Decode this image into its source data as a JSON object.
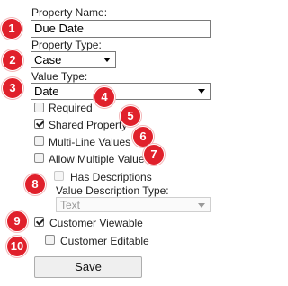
{
  "form": {
    "property_name_label": "Property Name:",
    "property_name_value": "Due Date",
    "property_type_label": "Property Type:",
    "property_type_value": "Case",
    "value_type_label": "Value Type:",
    "value_type_value": "Date",
    "required_label": "Required",
    "required_checked": false,
    "shared_property_label": "Shared Property",
    "shared_property_checked": true,
    "multi_line_label": "Multi-Line Values",
    "multi_line_checked": false,
    "allow_multiple_label": "Allow Multiple Values",
    "allow_multiple_checked": false,
    "has_descriptions_label": "Has Descriptions",
    "has_descriptions_checked": false,
    "value_description_type_label": "Value Description Type:",
    "value_description_type_value": "Text",
    "customer_viewable_label": "Customer Viewable",
    "customer_viewable_checked": true,
    "customer_editable_label": "Customer Editable",
    "customer_editable_checked": false,
    "save_label": "Save"
  },
  "badges": [
    "1",
    "2",
    "3",
    "4",
    "5",
    "6",
    "7",
    "8",
    "9",
    "10"
  ],
  "colors": {
    "badge": "#e0202b",
    "badge_text": "#ffffff"
  }
}
